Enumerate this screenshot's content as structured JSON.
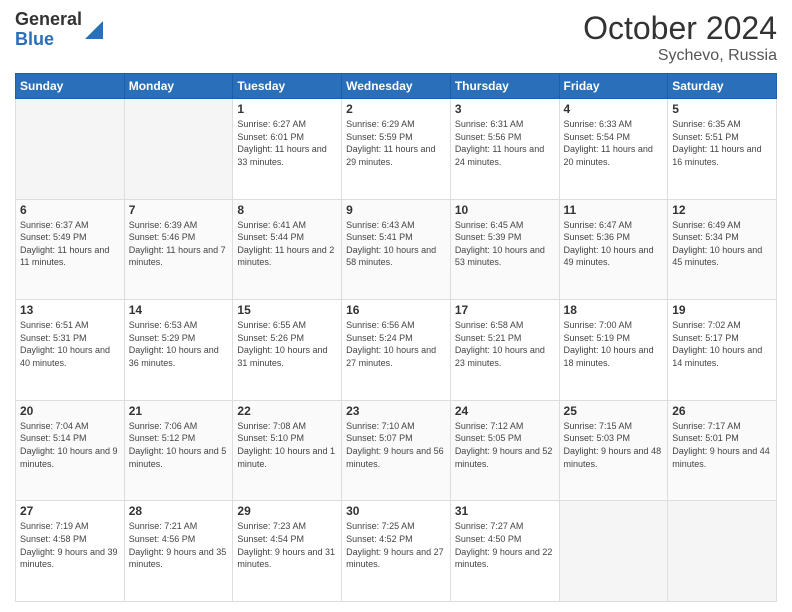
{
  "header": {
    "logo_general": "General",
    "logo_blue": "Blue",
    "title": "October 2024",
    "location": "Sychevo, Russia"
  },
  "columns": [
    "Sunday",
    "Monday",
    "Tuesday",
    "Wednesday",
    "Thursday",
    "Friday",
    "Saturday"
  ],
  "weeks": [
    [
      {
        "day": "",
        "info": ""
      },
      {
        "day": "",
        "info": ""
      },
      {
        "day": "1",
        "info": "Sunrise: 6:27 AM\nSunset: 6:01 PM\nDaylight: 11 hours and 33 minutes."
      },
      {
        "day": "2",
        "info": "Sunrise: 6:29 AM\nSunset: 5:59 PM\nDaylight: 11 hours and 29 minutes."
      },
      {
        "day": "3",
        "info": "Sunrise: 6:31 AM\nSunset: 5:56 PM\nDaylight: 11 hours and 24 minutes."
      },
      {
        "day": "4",
        "info": "Sunrise: 6:33 AM\nSunset: 5:54 PM\nDaylight: 11 hours and 20 minutes."
      },
      {
        "day": "5",
        "info": "Sunrise: 6:35 AM\nSunset: 5:51 PM\nDaylight: 11 hours and 16 minutes."
      }
    ],
    [
      {
        "day": "6",
        "info": "Sunrise: 6:37 AM\nSunset: 5:49 PM\nDaylight: 11 hours and 11 minutes."
      },
      {
        "day": "7",
        "info": "Sunrise: 6:39 AM\nSunset: 5:46 PM\nDaylight: 11 hours and 7 minutes."
      },
      {
        "day": "8",
        "info": "Sunrise: 6:41 AM\nSunset: 5:44 PM\nDaylight: 11 hours and 2 minutes."
      },
      {
        "day": "9",
        "info": "Sunrise: 6:43 AM\nSunset: 5:41 PM\nDaylight: 10 hours and 58 minutes."
      },
      {
        "day": "10",
        "info": "Sunrise: 6:45 AM\nSunset: 5:39 PM\nDaylight: 10 hours and 53 minutes."
      },
      {
        "day": "11",
        "info": "Sunrise: 6:47 AM\nSunset: 5:36 PM\nDaylight: 10 hours and 49 minutes."
      },
      {
        "day": "12",
        "info": "Sunrise: 6:49 AM\nSunset: 5:34 PM\nDaylight: 10 hours and 45 minutes."
      }
    ],
    [
      {
        "day": "13",
        "info": "Sunrise: 6:51 AM\nSunset: 5:31 PM\nDaylight: 10 hours and 40 minutes."
      },
      {
        "day": "14",
        "info": "Sunrise: 6:53 AM\nSunset: 5:29 PM\nDaylight: 10 hours and 36 minutes."
      },
      {
        "day": "15",
        "info": "Sunrise: 6:55 AM\nSunset: 5:26 PM\nDaylight: 10 hours and 31 minutes."
      },
      {
        "day": "16",
        "info": "Sunrise: 6:56 AM\nSunset: 5:24 PM\nDaylight: 10 hours and 27 minutes."
      },
      {
        "day": "17",
        "info": "Sunrise: 6:58 AM\nSunset: 5:21 PM\nDaylight: 10 hours and 23 minutes."
      },
      {
        "day": "18",
        "info": "Sunrise: 7:00 AM\nSunset: 5:19 PM\nDaylight: 10 hours and 18 minutes."
      },
      {
        "day": "19",
        "info": "Sunrise: 7:02 AM\nSunset: 5:17 PM\nDaylight: 10 hours and 14 minutes."
      }
    ],
    [
      {
        "day": "20",
        "info": "Sunrise: 7:04 AM\nSunset: 5:14 PM\nDaylight: 10 hours and 9 minutes."
      },
      {
        "day": "21",
        "info": "Sunrise: 7:06 AM\nSunset: 5:12 PM\nDaylight: 10 hours and 5 minutes."
      },
      {
        "day": "22",
        "info": "Sunrise: 7:08 AM\nSunset: 5:10 PM\nDaylight: 10 hours and 1 minute."
      },
      {
        "day": "23",
        "info": "Sunrise: 7:10 AM\nSunset: 5:07 PM\nDaylight: 9 hours and 56 minutes."
      },
      {
        "day": "24",
        "info": "Sunrise: 7:12 AM\nSunset: 5:05 PM\nDaylight: 9 hours and 52 minutes."
      },
      {
        "day": "25",
        "info": "Sunrise: 7:15 AM\nSunset: 5:03 PM\nDaylight: 9 hours and 48 minutes."
      },
      {
        "day": "26",
        "info": "Sunrise: 7:17 AM\nSunset: 5:01 PM\nDaylight: 9 hours and 44 minutes."
      }
    ],
    [
      {
        "day": "27",
        "info": "Sunrise: 7:19 AM\nSunset: 4:58 PM\nDaylight: 9 hours and 39 minutes."
      },
      {
        "day": "28",
        "info": "Sunrise: 7:21 AM\nSunset: 4:56 PM\nDaylight: 9 hours and 35 minutes."
      },
      {
        "day": "29",
        "info": "Sunrise: 7:23 AM\nSunset: 4:54 PM\nDaylight: 9 hours and 31 minutes."
      },
      {
        "day": "30",
        "info": "Sunrise: 7:25 AM\nSunset: 4:52 PM\nDaylight: 9 hours and 27 minutes."
      },
      {
        "day": "31",
        "info": "Sunrise: 7:27 AM\nSunset: 4:50 PM\nDaylight: 9 hours and 22 minutes."
      },
      {
        "day": "",
        "info": ""
      },
      {
        "day": "",
        "info": ""
      }
    ]
  ]
}
